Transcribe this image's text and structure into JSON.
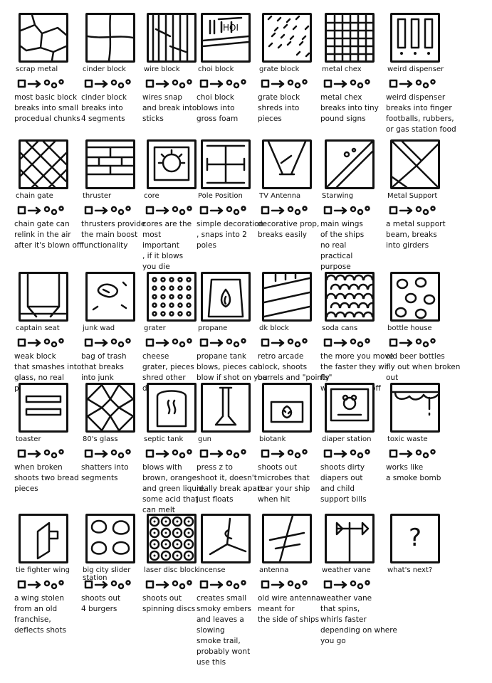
{
  "items": [
    {
      "name": "scrap metal",
      "desc": "most basic block\nbreaks into small\nprocedual chunks",
      "icon": "scrap-metal-icon"
    },
    {
      "name": "cinder block",
      "desc": "cinder block\nbreaks into\n4 segments",
      "icon": "cinder-block-icon"
    },
    {
      "name": "wire block",
      "desc": "wires snap\nand break into\nsticks",
      "icon": "wire-block-icon"
    },
    {
      "name": "choi block",
      "desc": "choi block\nblows into\ngross foam",
      "icon": "choi-block-icon"
    },
    {
      "name": "grate block",
      "desc": "grate block\nshreds into\npieces",
      "icon": "grate-block-icon"
    },
    {
      "name": "metal chex",
      "desc": "metal chex\nbreaks into tiny\npound signs",
      "icon": "metal-chex-icon"
    },
    {
      "name": "weird dispenser",
      "desc": "weird dispenser\nbreaks into finger\nfootballs, rubbers,\nor gas station food",
      "icon": "weird-dispenser-icon"
    },
    {
      "name": "chain gate",
      "desc": "chain gate can\nrelink in the air\nafter it's blown off",
      "icon": "chain-gate-icon"
    },
    {
      "name": "thruster",
      "desc": "thrusters provide\nthe main boost\nfunctionality",
      "icon": "thruster-icon"
    },
    {
      "name": "core",
      "desc": "cores are the\nmost\nimportant\n, if it blows\nyou die",
      "icon": "core-icon"
    },
    {
      "name": "Pole Position",
      "desc": "simple decoration\n, snaps into 2\npoles",
      "icon": "pole-position-icon"
    },
    {
      "name": "TV Antenna",
      "desc": "decorative prop,\nbreaks easily",
      "icon": "tv-antenna-icon"
    },
    {
      "name": "Starwing",
      "desc": "main wings\nof the ships\nno real\npractical\npurpose",
      "icon": "starwing-icon"
    },
    {
      "name": "Metal Support",
      "desc": "a metal support\nbeam, breaks\ninto girders",
      "icon": "metal-support-icon"
    },
    {
      "name": "captain seat",
      "desc": "weak block\nthat smashes into\nglass, no real purpose",
      "icon": "captain-seat-icon"
    },
    {
      "name": "junk wad",
      "desc": "bag of trash\nthat breaks\ninto junk",
      "icon": "junk-wad-icon"
    },
    {
      "name": "grater",
      "desc": "cheese\ngrater, pieces\nshred other\ndrops smaller",
      "icon": "grater-icon"
    },
    {
      "name": "propane",
      "desc": "propane tank\nblows, pieces can\nblow if shot on you",
      "icon": "propane-icon"
    },
    {
      "name": "dk block",
      "desc": "retro arcade\nblock, shoots\nbarrels and \"points\"",
      "icon": "dk-block-icon"
    },
    {
      "name": "soda cans",
      "desc": "the more you move\nthe faster they will fly\nwhen broken off",
      "icon": "soda-cans-icon"
    },
    {
      "name": "bottle house",
      "desc": "old beer bottles\nfly out when broken out",
      "icon": "bottle-house-icon"
    },
    {
      "name": "toaster",
      "desc": "when broken\nshoots two bread\npieces",
      "icon": "toaster-icon"
    },
    {
      "name": "80's glass",
      "desc": "shatters into\nsegments",
      "icon": "eighties-glass-icon"
    },
    {
      "name": "septic tank",
      "desc": "blows with\nbrown, orange\nand green liquid,\nsome acid that\ncan melt",
      "icon": "septic-tank-icon"
    },
    {
      "name": "gun",
      "desc": "press z to\nshoot it, doesn't\nreally break apart\njust floats",
      "icon": "gun-icon"
    },
    {
      "name": "biotank",
      "desc": "shoots out\nmicrobes that\ntear your ship\nwhen hit",
      "icon": "biotank-icon"
    },
    {
      "name": "diaper station",
      "desc": "shoots dirty\ndiapers out\nand child\nsupport bills",
      "icon": "diaper-station-icon"
    },
    {
      "name": "toxic waste",
      "desc": "works like\na smoke bomb",
      "icon": "toxic-waste-icon"
    },
    {
      "name": "tie fighter wing",
      "desc": "a wing stolen\nfrom an old\nfranchise,\ndeflects shots",
      "icon": "tie-fighter-wing-icon"
    },
    {
      "name": "big city slider\nstation",
      "desc": "shoots out\n4 burgers",
      "icon": "big-city-slider-icon"
    },
    {
      "name": "laser disc block",
      "desc": "shoots out\nspinning discs",
      "icon": "laser-disc-block-icon"
    },
    {
      "name": "incense",
      "desc": "creates small\nsmoky embers\nand leaves a\nslowing\nsmoke trail,\nprobably wont\nuse this",
      "icon": "incense-icon"
    },
    {
      "name": "antenna",
      "desc": "old wire antenna\nmeant for\nthe side of ships",
      "icon": "antenna-icon"
    },
    {
      "name": "weather vane",
      "desc": "weather vane\nthat spins,\nwhirls faster\ndepending on where\nyou go",
      "icon": "weather-vane-icon"
    },
    {
      "name": "what's next?",
      "desc": "",
      "icon": "question-mark-icon"
    }
  ]
}
